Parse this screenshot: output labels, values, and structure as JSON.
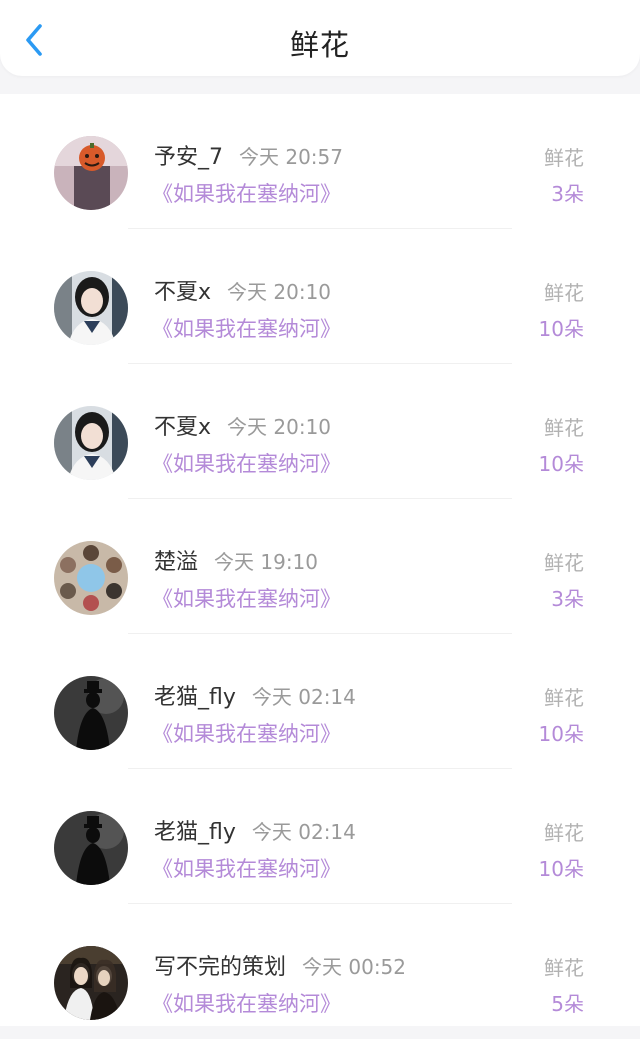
{
  "header": {
    "title": "鲜花"
  },
  "rows": [
    {
      "name": "予安_7",
      "time": "今天 20:57",
      "book": "《如果我在塞纳河》",
      "gift": "鲜花",
      "count": "3朵"
    },
    {
      "name": "不夏x",
      "time": "今天 20:10",
      "book": "《如果我在塞纳河》",
      "gift": "鲜花",
      "count": "10朵"
    },
    {
      "name": "不夏x",
      "time": "今天 20:10",
      "book": "《如果我在塞纳河》",
      "gift": "鲜花",
      "count": "10朵"
    },
    {
      "name": "楚溢",
      "time": "今天 19:10",
      "book": "《如果我在塞纳河》",
      "gift": "鲜花",
      "count": "3朵"
    },
    {
      "name": "老猫_fly",
      "time": "今天 02:14",
      "book": "《如果我在塞纳河》",
      "gift": "鲜花",
      "count": "10朵"
    },
    {
      "name": "老猫_fly",
      "time": "今天 02:14",
      "book": "《如果我在塞纳河》",
      "gift": "鲜花",
      "count": "10朵"
    },
    {
      "name": "写不完的策划",
      "time": "今天 00:52",
      "book": "《如果我在塞纳河》",
      "gift": "鲜花",
      "count": "5朵"
    }
  ],
  "colors": {
    "accent_purple": "#b48ad8",
    "back_blue": "#2b9af3",
    "muted_gray": "#9a9a9a"
  }
}
